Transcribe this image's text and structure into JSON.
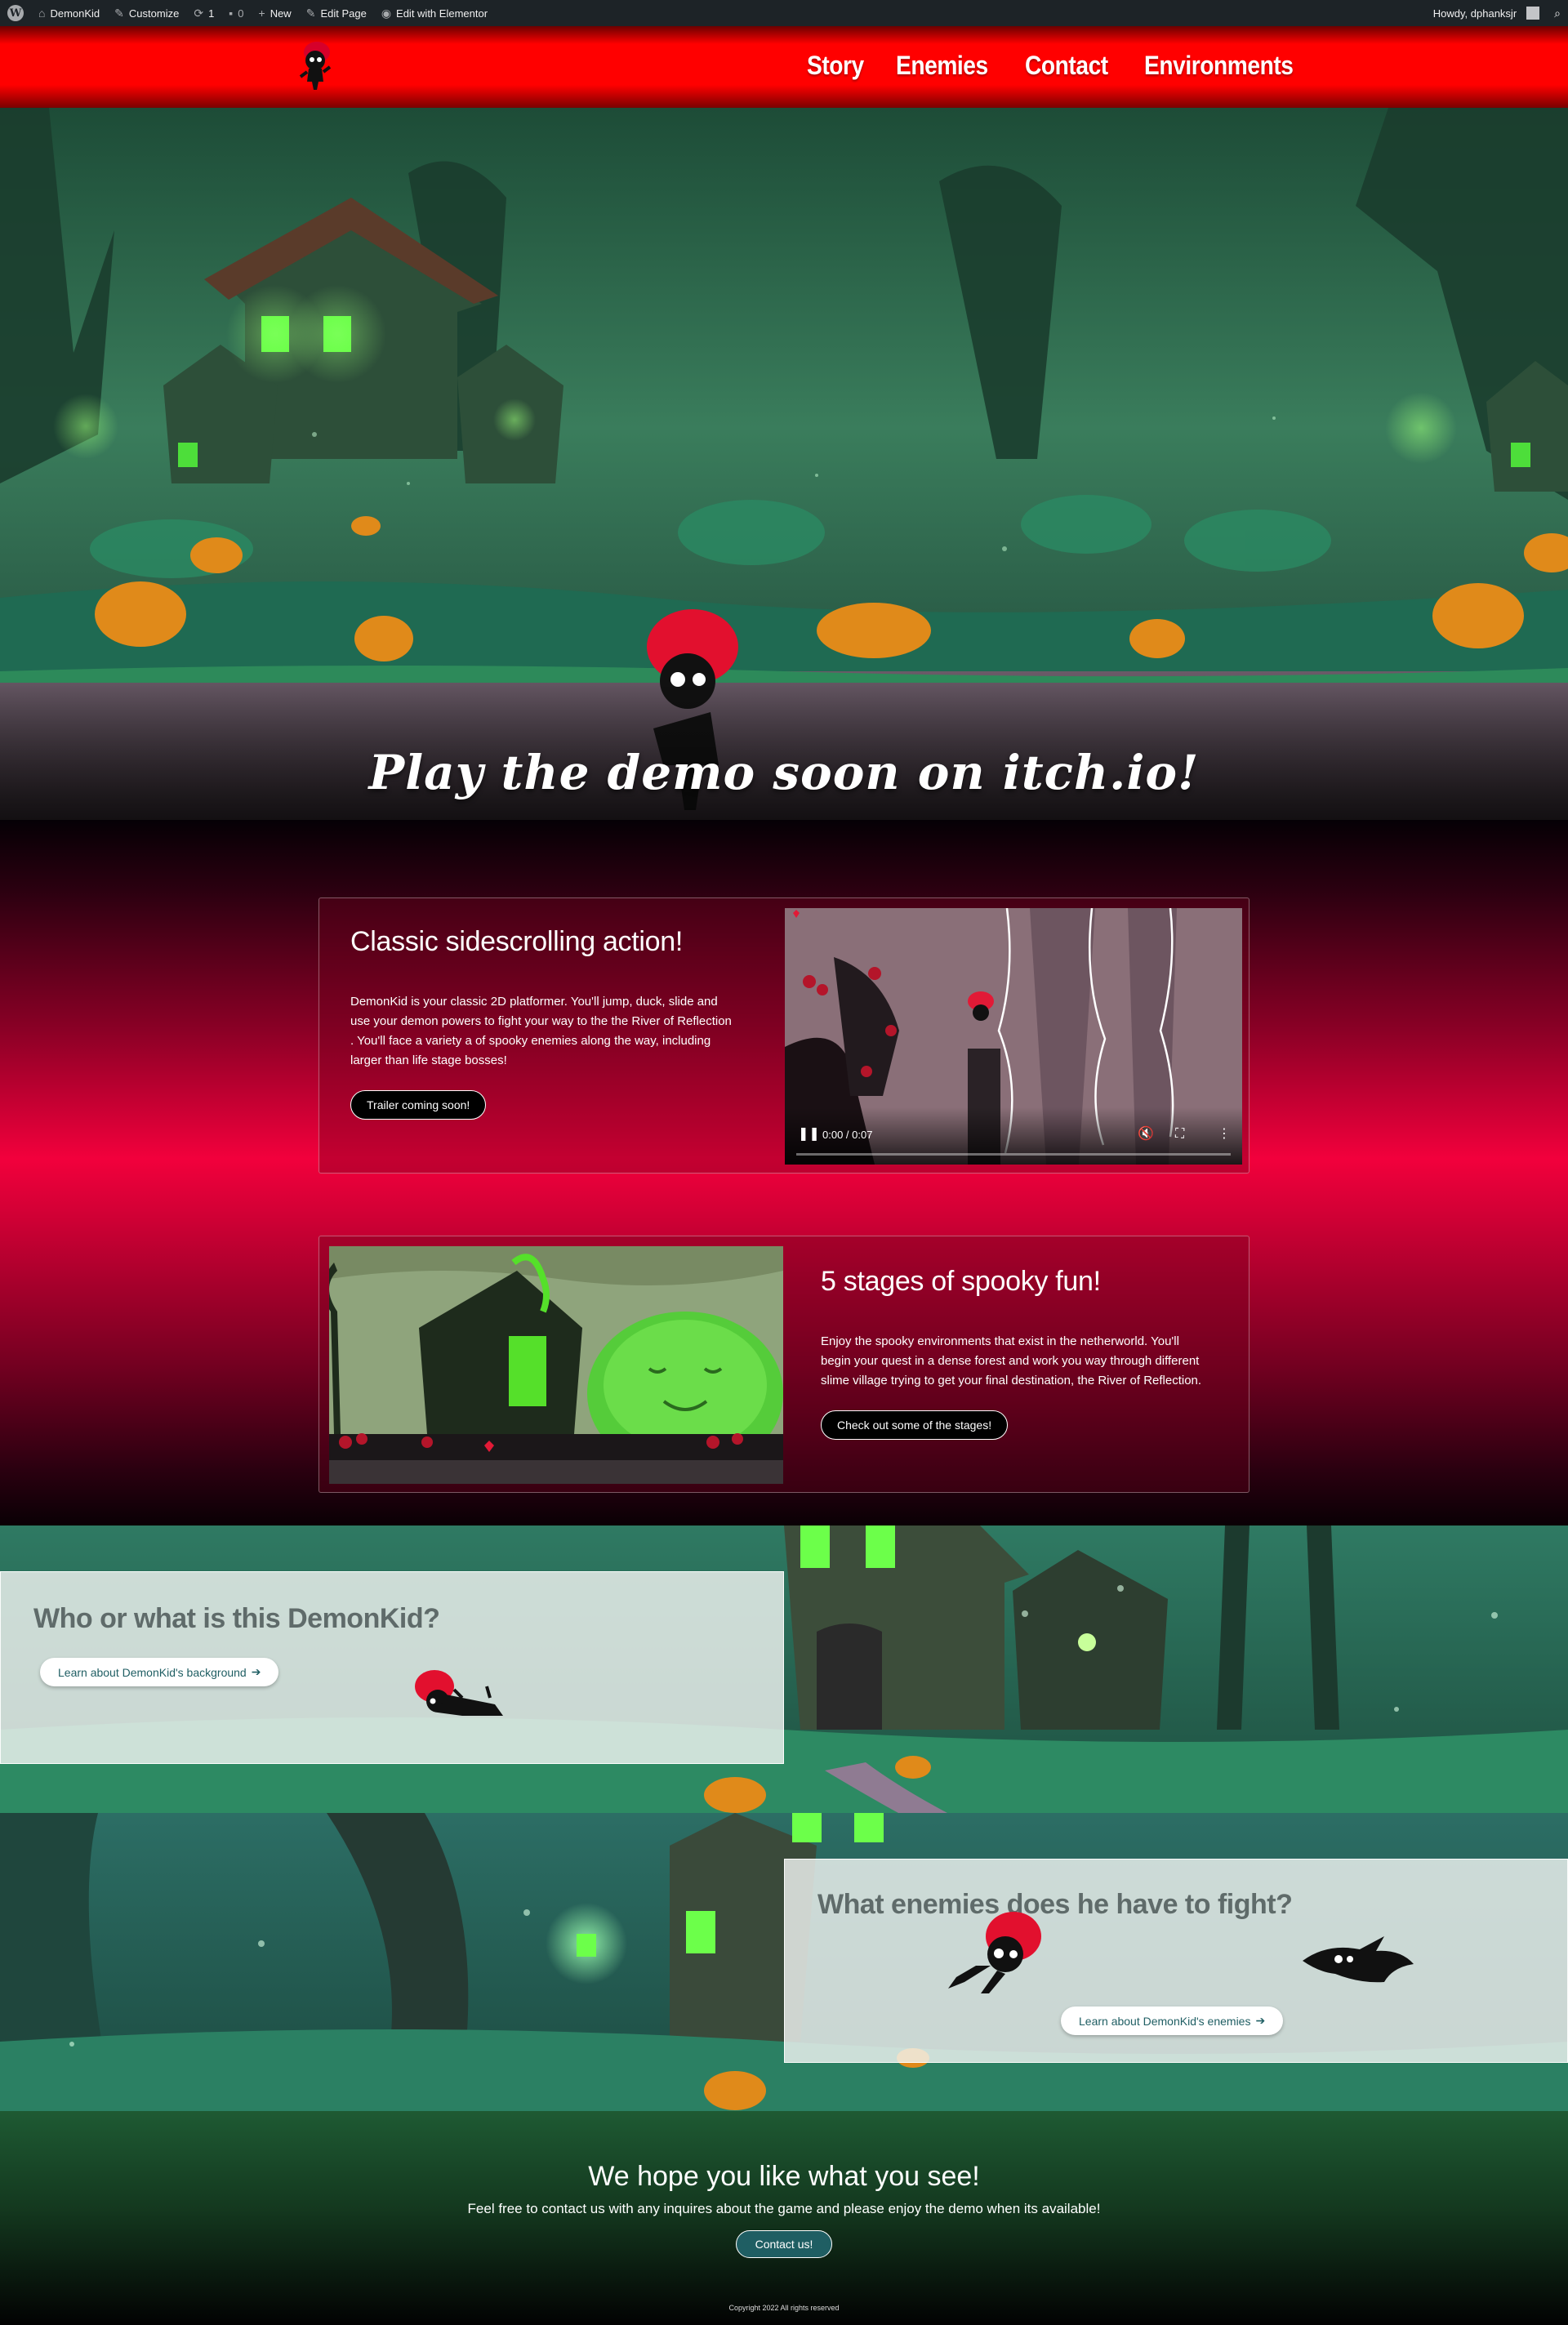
{
  "adminbar": {
    "site_name": "DemonKid",
    "customize": "Customize",
    "updates_count": "1",
    "comments_count": "0",
    "new": "New",
    "edit_page": "Edit Page",
    "edit_elementor": "Edit with Elementor",
    "howdy": "Howdy, dphanksjr"
  },
  "header": {
    "nav": [
      "Story",
      "Enemies",
      "Contact",
      "Environments"
    ]
  },
  "hero": {
    "caption": "Play the demo soon on itch.io!"
  },
  "section1": {
    "title": "Classic sidescrolling action!",
    "body": "DemonKid is your classic 2D platformer.   You'll  jump, duck, slide and use your demon powers to fight your way to the the River of Reflection .  You'll face a variety a of  spooky enemies along the way, including larger than life stage bosses!",
    "button": "Trailer coming soon!",
    "video_time": "0:00 / 0:07"
  },
  "section2": {
    "title": "5 stages of spooky fun!",
    "body": "Enjoy the spooky environments that exist in the netherworld. You'll  begin your quest in a dense forest and work you way through different slime village trying to get your final destination, the River of Reflection.",
    "button": "Check out some of the stages!"
  },
  "section3": {
    "title": "Who or what is this DemonKid?",
    "button": "Learn about DemonKid's background"
  },
  "section4": {
    "title": "What enemies does he have to fight?",
    "button": "Learn about DemonKid's enemies"
  },
  "footer": {
    "title": "We hope you like what you see!",
    "text": "Feel free to contact us with any inquires about the game and please enjoy the demo when its available!",
    "button": "Contact us!",
    "copyright": "Copyright 2022 All rights reserved"
  },
  "colors": {
    "header_red": "#ff0000",
    "band_pink": "#f2003c",
    "accent_teal": "#1f5e63",
    "admin_bar": "#1d2327"
  }
}
